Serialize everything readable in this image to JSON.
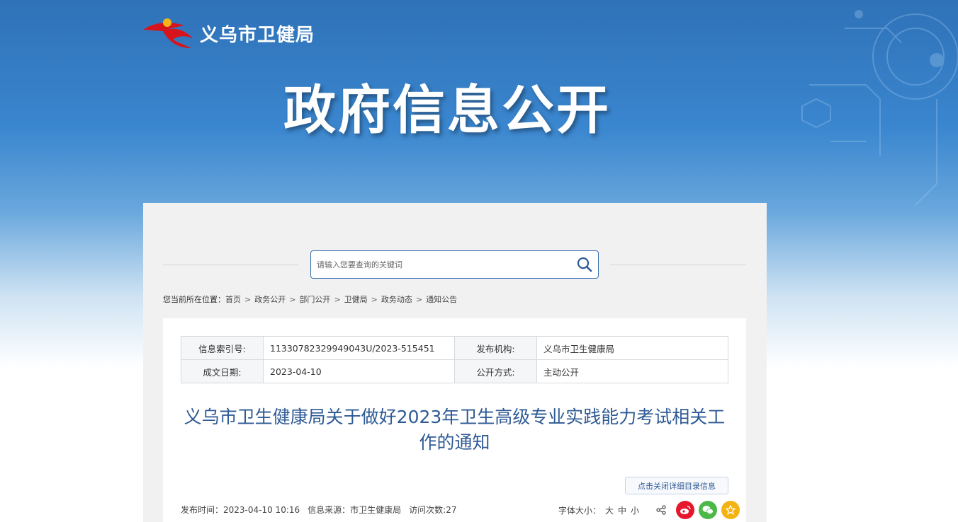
{
  "header": {
    "site_name": "义乌市卫健局",
    "banner_title": "政府信息公开"
  },
  "search": {
    "placeholder": "请输入您要查询的关键词"
  },
  "breadcrumb": {
    "label": "您当前所在位置：",
    "items": [
      "首页",
      "政务公开",
      "部门公开",
      "卫健局",
      "政务动态",
      "通知公告"
    ],
    "separator": ">"
  },
  "meta_table": {
    "index_label": "信息索引号:",
    "index_value": "11330782329949043U/2023-515451",
    "publisher_label": "发布机构:",
    "publisher_value": "义乌市卫生健康局",
    "date_label": "成文日期:",
    "date_value": "2023-04-10",
    "mode_label": "公开方式:",
    "mode_value": "主动公开"
  },
  "document": {
    "title": "义乌市卫生健康局关于做好2023年卫生高级专业实践能力考试相关工作的通知",
    "toggle_label": "点击关闭详细目录信息"
  },
  "info_bar": {
    "publish_time": "发布时间：2023-04-10 10:16",
    "source": "信息来源：市卫生健康局",
    "visits": "访问次数:27"
  },
  "tools": {
    "font_size_label": "字体大小：",
    "font_large": "大",
    "font_medium": "中",
    "font_small": "小"
  },
  "colors": {
    "accent": "#2e5a95",
    "search_border": "#3b6fb0",
    "weibo": "#e6162d",
    "wechat": "#4cb848",
    "favorite": "#f3b312"
  }
}
